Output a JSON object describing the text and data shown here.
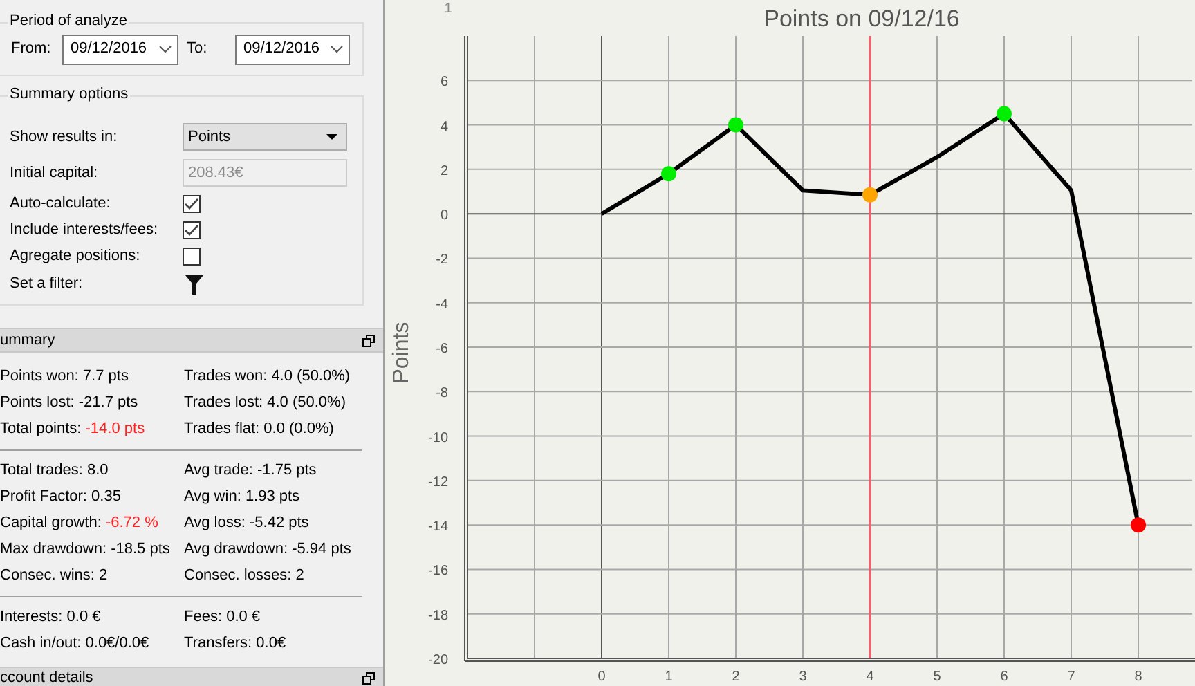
{
  "period": {
    "title": "Period of analyze",
    "from_label": "From:",
    "from_value": "09/12/2016",
    "to_label": "To:",
    "to_value": "09/12/2016"
  },
  "summary_options": {
    "title": "Summary options",
    "rows": [
      {
        "kind": "select",
        "label": "Show results in:",
        "value": "Points"
      },
      {
        "kind": "text",
        "label": "Initial capital:",
        "value": "208.43€",
        "disabled": true
      },
      {
        "kind": "checkbox",
        "label": "Auto-calculate:",
        "checked": true
      },
      {
        "kind": "checkbox",
        "label": "Include interests/fees:",
        "checked": true
      },
      {
        "kind": "checkbox",
        "label": "Agregate positions:",
        "checked": false
      },
      {
        "kind": "filter",
        "label": "Set a filter:"
      }
    ]
  },
  "summary": {
    "title": "ummary",
    "sections": [
      [
        [
          {
            "label": "Points won:",
            "value": "7.7 pts",
            "highlight": false
          },
          {
            "label": "Trades won:",
            "value": "4.0 (50.0%)",
            "highlight": false
          }
        ],
        [
          {
            "label": "Points lost:",
            "value": "-21.7 pts",
            "highlight": false
          },
          {
            "label": "Trades lost:",
            "value": "4.0 (50.0%)",
            "highlight": false
          }
        ],
        [
          {
            "label": "Total points:",
            "value": "-14.0 pts",
            "highlight": true
          },
          {
            "label": "Trades flat:",
            "value": "0.0 (0.0%)",
            "highlight": false
          }
        ]
      ],
      [
        [
          {
            "label": "Total trades:",
            "value": "8.0",
            "highlight": false
          },
          {
            "label": "Avg trade:",
            "value": "-1.75 pts",
            "highlight": false
          }
        ],
        [
          {
            "label": "Profit Factor:",
            "value": "0.35",
            "highlight": false
          },
          {
            "label": "Avg win:",
            "value": "1.93 pts",
            "highlight": false
          }
        ],
        [
          {
            "label": "Capital growth:",
            "value": "-6.72 %",
            "highlight": true
          },
          {
            "label": "Avg loss:",
            "value": "-5.42 pts",
            "highlight": false
          }
        ],
        [
          {
            "label": "Max drawdown:",
            "value": "-18.5 pts",
            "highlight": false
          },
          {
            "label": "Avg drawdown:",
            "value": "-5.94 pts",
            "highlight": false
          }
        ],
        [
          {
            "label": "Consec. wins:",
            "value": "2",
            "highlight": false
          },
          {
            "label": "Consec. losses:",
            "value": "2",
            "highlight": false
          }
        ]
      ],
      [
        [
          {
            "label": "Interests:",
            "value": "0.0 €",
            "highlight": false
          },
          {
            "label": "Fees:",
            "value": "0.0 €",
            "highlight": false
          }
        ],
        [
          {
            "label": "Cash in/out:",
            "value": "0.0€/0.0€",
            "highlight": false
          },
          {
            "label": "Transfers:",
            "value": "0.0€",
            "highlight": false
          }
        ]
      ]
    ]
  },
  "account_details": {
    "title": "ccount details"
  },
  "chart": {
    "corner_label": "1",
    "markers": [
      {
        "kind": "plain"
      },
      {
        "kind": "dot",
        "color": "#00ee00"
      },
      {
        "kind": "dot",
        "color": "#00ee00"
      },
      {
        "kind": "plain"
      },
      {
        "kind": "dot",
        "color": "#ffa500"
      },
      {
        "kind": "plain"
      },
      {
        "kind": "dot",
        "color": "#00ee00"
      },
      {
        "kind": "plain"
      },
      {
        "kind": "dot",
        "color": "#ff0000"
      }
    ],
    "chart_data": {
      "type": "line",
      "title": "Points on 09/12/16",
      "ylabel": "Points",
      "grid": true,
      "x": [
        0,
        1,
        2,
        3,
        4,
        5,
        6,
        7,
        8
      ],
      "series": [
        {
          "color": "#000000",
          "values": [
            0,
            1.8,
            4.0,
            1.05,
            0.85,
            2.55,
            4.5,
            1.05,
            -14.0
          ]
        }
      ],
      "xlim": [
        -2,
        8.8
      ],
      "ylim": [
        -20,
        8
      ],
      "xticks": [
        0,
        1,
        2,
        3,
        4,
        5,
        6,
        7,
        8
      ],
      "yticks": [
        -20,
        -18,
        -16,
        -14,
        -12,
        -10,
        -8,
        -6,
        -4,
        -2,
        0,
        2,
        4,
        6
      ],
      "ref_lines": [
        {
          "axis": "x",
          "value": 4,
          "color": "#ff5a6a"
        }
      ]
    }
  }
}
